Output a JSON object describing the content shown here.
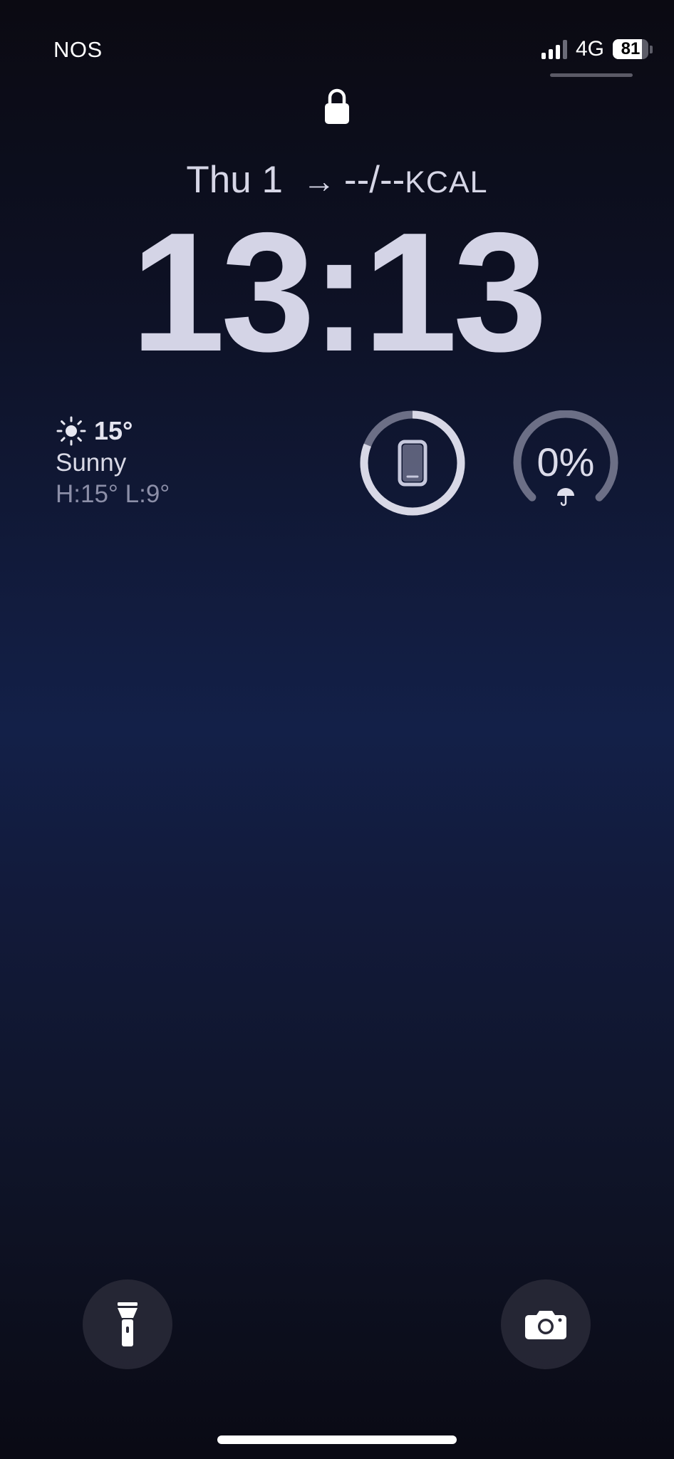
{
  "status_bar": {
    "carrier": "NOS",
    "network": "4G",
    "battery_level": "81",
    "battery_fraction": 0.81
  },
  "lock_screen": {
    "date": "Thu 1",
    "activity": "--/--",
    "activity_unit": "KCAL",
    "time": "13:13"
  },
  "weather": {
    "temperature": "15°",
    "condition": "Sunny",
    "high_low": "H:15° L:9°",
    "icon": "sun-icon"
  },
  "widgets": {
    "device_battery_icon": "phone-icon",
    "rain_chance": "0%",
    "rain_icon": "umbrella-icon"
  },
  "quick_actions": {
    "left_icon": "flashlight-icon",
    "right_icon": "camera-icon"
  },
  "colors": {
    "text_primary": "#d4d4e6",
    "background_mid": "#132048"
  }
}
